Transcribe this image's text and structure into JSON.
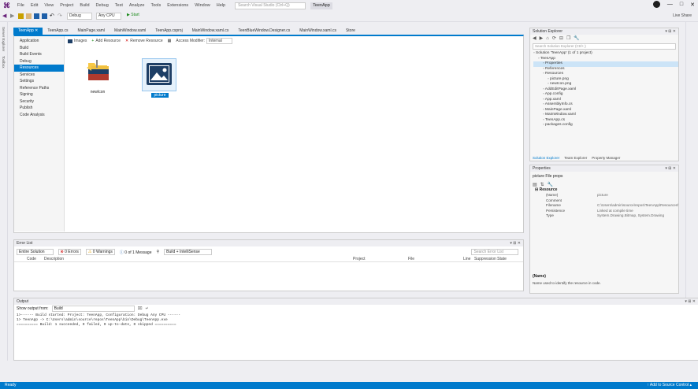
{
  "menubar": {
    "items": [
      "File",
      "Edit",
      "View",
      "Project",
      "Build",
      "Debug",
      "Test",
      "Analyze",
      "Tools",
      "Extensions",
      "Window",
      "Help"
    ],
    "search_placeholder": "Search Visual Studio (Ctrl+Q)",
    "project_title": "TeenApp"
  },
  "toolbar": {
    "config": "Debug",
    "platform": "Any CPU",
    "start_label": "▶ Start",
    "live_share": "Live Share"
  },
  "left_strip": {
    "items": [
      "Server Explorer",
      "Toolbox"
    ]
  },
  "doc_tabs": [
    {
      "label": "TeenApp ✕",
      "active": true
    },
    {
      "label": "TeenApp.cs",
      "active": false
    },
    {
      "label": "MainPage.xaml",
      "active": false
    },
    {
      "label": "MainWindow.xaml",
      "active": false
    },
    {
      "label": "TeenApp.csproj",
      "active": false
    },
    {
      "label": "MainWindow.xaml.cs",
      "active": false
    },
    {
      "label": "TeenBlueWindow.Designer.cs",
      "active": false
    },
    {
      "label": "MainWindow.xaml.cs",
      "active": false
    },
    {
      "label": "Store",
      "active": false
    }
  ],
  "resources": {
    "categories": [
      "Application",
      "Build",
      "Build Events",
      "Debug",
      "Resources",
      "Services",
      "Settings",
      "Reference Paths",
      "Signing",
      "Security",
      "Publish",
      "Code Analysis"
    ],
    "selected_index": 4,
    "toolbar": {
      "images_label": "Images",
      "add_resource_label": "Add Resource",
      "remove_resource_label": "Remove Resource",
      "access_modifier_label": "Access Modifier:",
      "access_modifier_value": "Internal"
    },
    "items": [
      {
        "name": "newIcon",
        "icon": "folder-icon",
        "selected": false
      },
      {
        "name": "picture",
        "icon": "image-icon",
        "selected": true
      }
    ]
  },
  "error_list": {
    "title": "Error List",
    "scope": "Entire Solution",
    "errors": "0 Errors",
    "warnings": "0 Warnings",
    "messages": "0 of 1 Message",
    "build_filter": "Build + IntelliSense",
    "search_placeholder": "Search Error List",
    "columns": [
      "Code",
      "Description",
      "Project",
      "File",
      "Line",
      "Suppression State"
    ]
  },
  "output": {
    "title": "Output",
    "source_label": "Show output from:",
    "source_value": "Build",
    "lines": [
      "1>------ Build started: Project: TeenApp, Configuration: Debug Any CPU ------",
      "1>  TeenApp -> C:\\Users\\admin\\source\\repos\\TeenApp\\bin\\Debug\\TeenApp.exe",
      "========== Build: 1 succeeded, 0 failed, 0 up-to-date, 0 skipped =========="
    ]
  },
  "solution_explorer": {
    "title": "Solution Explorer",
    "search_placeholder": "Search Solution Explorer (Ctrl+;)",
    "nodes": [
      {
        "label": "Solution 'TeenApp' (1 of 1 project)",
        "depth": 0,
        "selected": false
      },
      {
        "label": "TeenApp",
        "depth": 1,
        "selected": false
      },
      {
        "label": "Properties",
        "depth": 2,
        "selected": true
      },
      {
        "label": "References",
        "depth": 2,
        "selected": false
      },
      {
        "label": "Resources",
        "depth": 2,
        "selected": false
      },
      {
        "label": "picture.png",
        "depth": 3,
        "selected": false
      },
      {
        "label": "newIcon.png",
        "depth": 3,
        "selected": false
      },
      {
        "label": "AddEditPage.xaml",
        "depth": 2,
        "selected": false
      },
      {
        "label": "App.config",
        "depth": 2,
        "selected": false
      },
      {
        "label": "App.xaml",
        "depth": 2,
        "selected": false
      },
      {
        "label": "AssemblyInfo.cs",
        "depth": 2,
        "selected": false
      },
      {
        "label": "MainPage.xaml",
        "depth": 2,
        "selected": false
      },
      {
        "label": "MainWindow.xaml",
        "depth": 2,
        "selected": false
      },
      {
        "label": "TeenApp.cs",
        "depth": 2,
        "selected": false
      },
      {
        "label": "packages.config",
        "depth": 2,
        "selected": false
      }
    ],
    "bottom_tabs": [
      "Solution Explorer",
      "Team Explorer",
      "Property Manager"
    ]
  },
  "properties": {
    "title": "Properties",
    "object": "picture File props",
    "section": "Resource",
    "rows": [
      {
        "key": "(Name)",
        "value": "picture"
      },
      {
        "key": "Comment",
        "value": ""
      },
      {
        "key": "Filename",
        "value": "C:\\Users\\admin\\source\\repos\\TeenApp\\Resources\\picture.png"
      },
      {
        "key": "Persistence",
        "value": "Linked at compile time"
      },
      {
        "key": "Type",
        "value": "System.Drawing.Bitmap, System.Drawing"
      }
    ],
    "desc_title": "(Name)",
    "desc_text": "Name used to identify the resource in code."
  },
  "status": {
    "left": "Ready",
    "right": "↑ Add to Source Control ▴"
  },
  "colors": {
    "accent": "#007acc",
    "chrome": "#eeeef2",
    "folder": "#f7c948",
    "image_icon": "#1e3f66"
  }
}
